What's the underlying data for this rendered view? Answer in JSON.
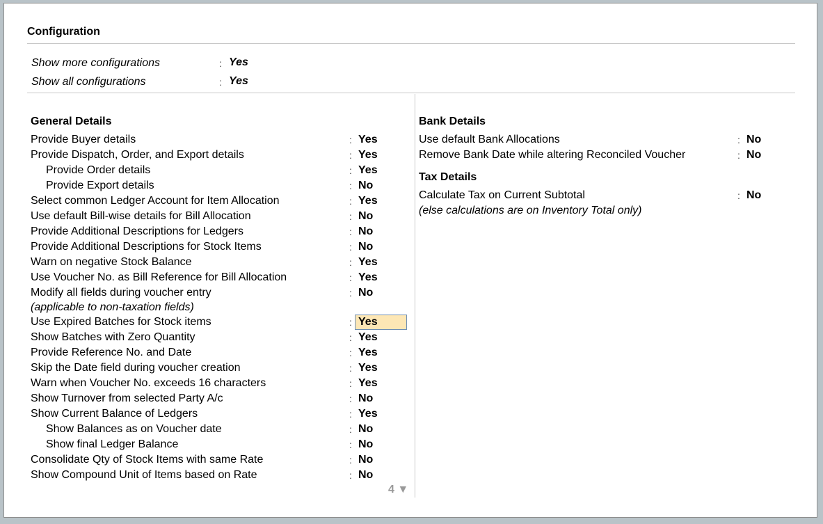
{
  "dialog": {
    "title": "Configuration",
    "top_options": [
      {
        "label": "Show more configurations",
        "value": "Yes"
      },
      {
        "label": "Show all configurations",
        "value": "Yes"
      }
    ]
  },
  "general": {
    "heading": "General Details",
    "rows": [
      {
        "label": "Provide Buyer details",
        "value": "Yes"
      },
      {
        "label": "Provide Dispatch, Order, and Export details",
        "value": "Yes"
      },
      {
        "label": "Provide Order details",
        "value": "Yes"
      },
      {
        "label": "Provide Export details",
        "value": "No"
      },
      {
        "label": "Select common Ledger Account for Item Allocation",
        "value": "Yes"
      },
      {
        "label": "Use default Bill-wise details for Bill Allocation",
        "value": "No"
      },
      {
        "label": "Provide Additional Descriptions for Ledgers",
        "value": "No"
      },
      {
        "label": "Provide Additional Descriptions for Stock Items",
        "value": "No"
      },
      {
        "label": "Warn on negative Stock Balance",
        "value": "Yes"
      },
      {
        "label": "Use Voucher No. as Bill Reference for Bill Allocation",
        "value": "Yes"
      },
      {
        "label": "Modify all fields during voucher entry",
        "value": "No"
      },
      {
        "label": "Use Expired Batches for Stock items",
        "value": "Yes"
      },
      {
        "label": "Show Batches with Zero Quantity",
        "value": "Yes"
      },
      {
        "label": "Provide Reference No. and Date",
        "value": "Yes"
      },
      {
        "label": "Skip the Date field during voucher creation",
        "value": "Yes"
      },
      {
        "label": "Warn when Voucher No. exceeds 16 characters",
        "value": "Yes"
      },
      {
        "label": "Show Turnover from selected Party A/c",
        "value": "No"
      },
      {
        "label": "Show Current Balance of Ledgers",
        "value": "Yes"
      },
      {
        "label": "Show Balances as on Voucher date",
        "value": "No"
      },
      {
        "label": "Show final Ledger Balance",
        "value": "No"
      },
      {
        "label": "Consolidate Qty of Stock Items with same Rate",
        "value": "No"
      },
      {
        "label": "Show Compound Unit of Items based on Rate",
        "value": "No"
      }
    ],
    "note_modify": "(applicable to non-taxation fields)",
    "page_indicator": "4 ▼"
  },
  "bank": {
    "heading": "Bank Details",
    "rows": [
      {
        "label": "Use default Bank Allocations",
        "value": "No"
      },
      {
        "label": "Remove Bank Date while altering Reconciled Voucher",
        "value": "No"
      }
    ]
  },
  "tax": {
    "heading": "Tax Details",
    "rows": [
      {
        "label": "Calculate Tax on Current Subtotal",
        "value": "No"
      }
    ],
    "note": "(else calculations are on Inventory Total only)"
  },
  "colon": ":"
}
